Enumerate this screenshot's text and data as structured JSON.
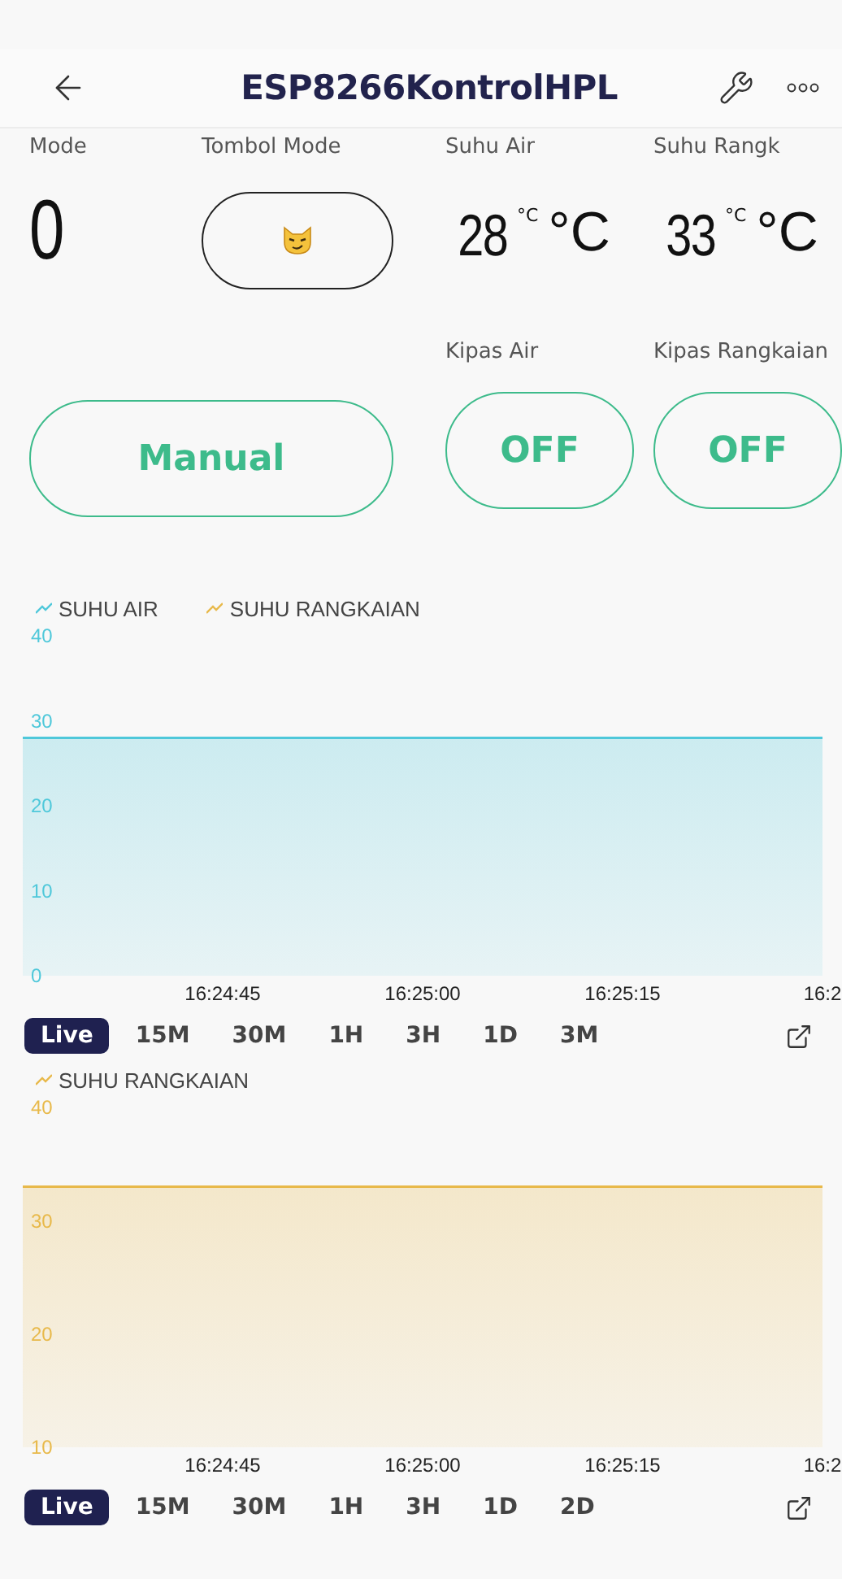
{
  "header": {
    "title": "ESP8266KontrolHPL"
  },
  "widgets": [
    {
      "kind": "value",
      "label": "Mode",
      "value": "0"
    },
    {
      "kind": "icon_button",
      "label": "Tombol Mode",
      "color": "#222222"
    },
    {
      "kind": "temperature",
      "label": "Suhu Air",
      "value": "28",
      "suffix": "°C",
      "unit": "°C"
    },
    {
      "kind": "temperature",
      "label": "Suhu Rangk",
      "value": "33",
      "suffix": "°C",
      "unit": "°C"
    },
    {
      "kind": "wide_button",
      "value": "Manual",
      "color": "#3dbb8b"
    },
    {
      "kind": "switch",
      "label": "Kipas Air",
      "value": "OFF",
      "color": "#3dbb8b"
    },
    {
      "kind": "switch",
      "label": "Kipas Rangkaian",
      "value": "OFF",
      "color": "#3dbb8b"
    }
  ],
  "charts": [
    {
      "chart_data": {
        "type": "area",
        "categories": [
          null,
          "16:24:45",
          "16:25:00",
          "16:25:15",
          "16:2"
        ],
        "ylim": [
          0,
          40
        ],
        "yticks": [
          0,
          10,
          20,
          30,
          40
        ],
        "series": [
          {
            "name": "SUHU AIR",
            "color": "#4fc8da",
            "values": [
              28,
              28,
              28,
              28,
              28
            ]
          },
          {
            "name": "SUHU RANGKAIAN",
            "color": "#e8b94a",
            "values": [
              null,
              null,
              null,
              null,
              null
            ]
          }
        ]
      },
      "periods": [
        {
          "label": "Live",
          "selected": true
        },
        {
          "label": "15M",
          "selected": false
        },
        {
          "label": "30M",
          "selected": false
        },
        {
          "label": "1H",
          "selected": false
        },
        {
          "label": "3H",
          "selected": false
        },
        {
          "label": "1D",
          "selected": false
        },
        {
          "label": "3M",
          "selected": false
        }
      ]
    },
    {
      "chart_data": {
        "type": "area",
        "categories": [
          null,
          "16:24:45",
          "16:25:00",
          "16:25:15",
          "16:2"
        ],
        "ylim": [
          10,
          40
        ],
        "yticks": [
          10,
          20,
          30,
          40
        ],
        "series": [
          {
            "name": "SUHU RANGKAIAN",
            "color": "#e8b94a",
            "values": [
              33,
              33,
              33,
              33,
              33
            ]
          }
        ]
      },
      "periods": [
        {
          "label": "Live",
          "selected": true
        },
        {
          "label": "15M",
          "selected": false
        },
        {
          "label": "30M",
          "selected": false
        },
        {
          "label": "1H",
          "selected": false
        },
        {
          "label": "3H",
          "selected": false
        },
        {
          "label": "1D",
          "selected": false
        },
        {
          "label": "2D",
          "selected": false
        }
      ]
    }
  ]
}
